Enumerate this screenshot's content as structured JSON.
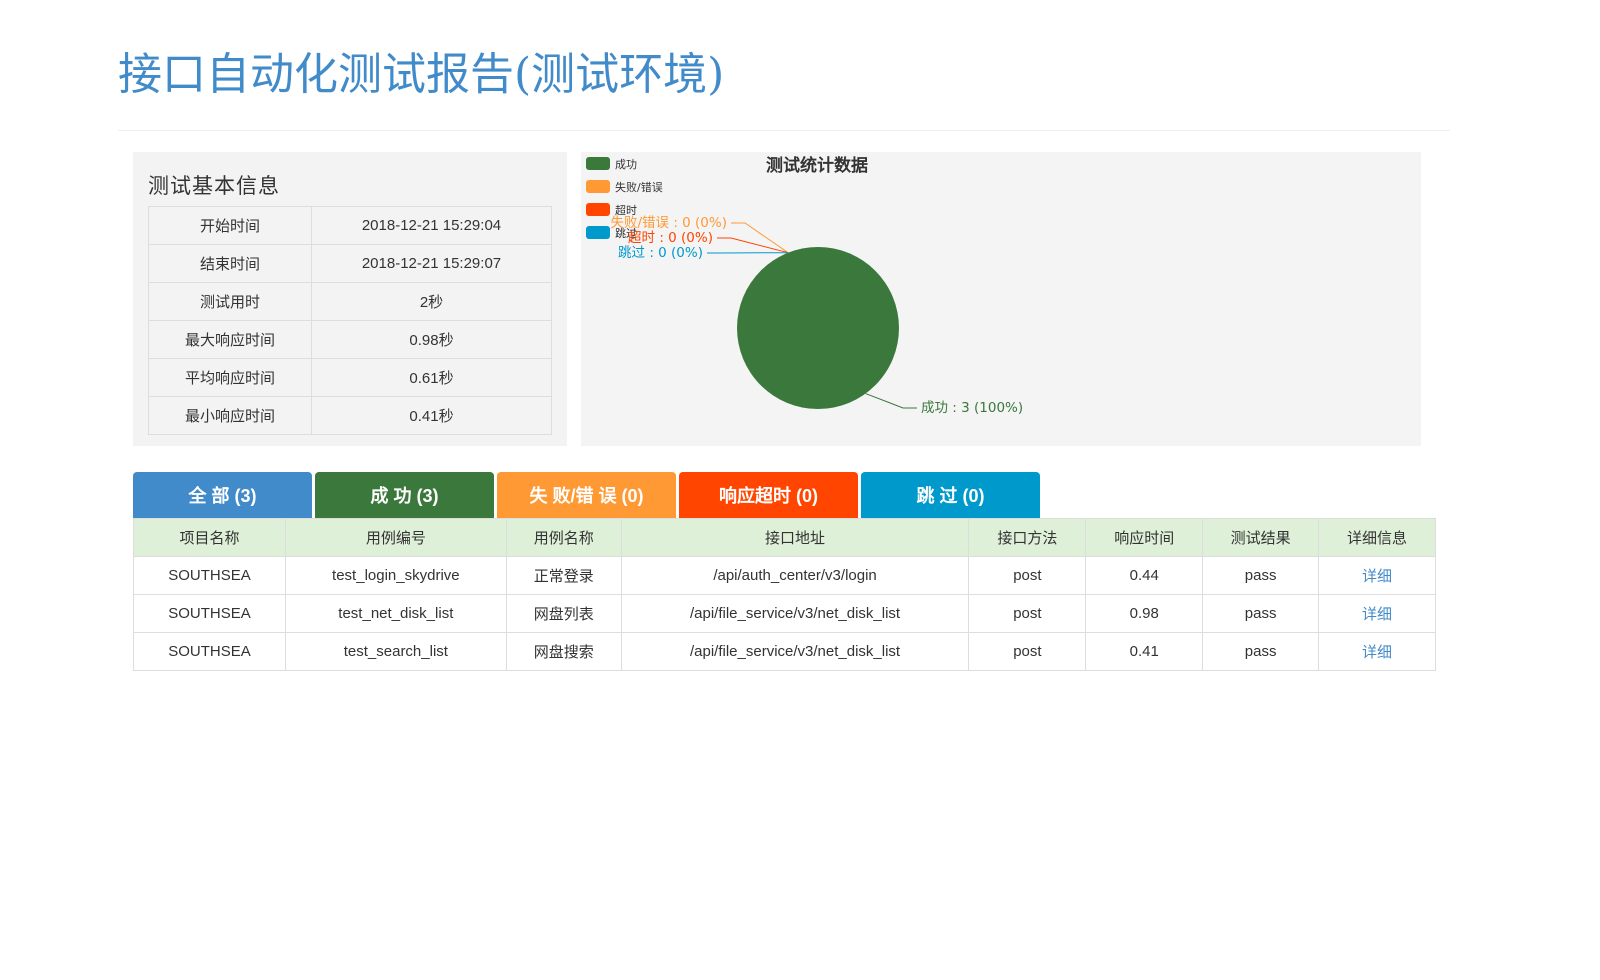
{
  "page": {
    "title": "接口自动化测试报告(测试环境)"
  },
  "basic_info": {
    "title": "测试基本信息",
    "rows": [
      {
        "label": "开始时间",
        "value": "2018-12-21 15:29:04"
      },
      {
        "label": "结束时间",
        "value": "2018-12-21 15:29:07"
      },
      {
        "label": "测试用时",
        "value": "2秒"
      },
      {
        "label": "最大响应时间",
        "value": "0.98秒"
      },
      {
        "label": "平均响应时间",
        "value": "0.61秒"
      },
      {
        "label": "最小响应时间",
        "value": "0.41秒"
      }
    ]
  },
  "chart_data": {
    "type": "pie",
    "title": "测试统计数据",
    "legend_position": "top-left",
    "categories": [
      "成功",
      "失败/错误",
      "超时",
      "跳过"
    ],
    "values": [
      3,
      0,
      0,
      0
    ],
    "colors": [
      "#3b783c",
      "#ff9933",
      "#ff4500",
      "#0099cc"
    ],
    "data_labels": [
      "成功 : 3 (100%)",
      "失败/错误 : 0 (0%)",
      "超时 : 0 (0%)",
      "跳过 : 0 (0%)"
    ]
  },
  "tabs": [
    {
      "label": "全 部 (3)",
      "color": "#428bca"
    },
    {
      "label": "成 功 (3)",
      "color": "#3b783c"
    },
    {
      "label": "失 败/错 误 (0)",
      "color": "#ff9933"
    },
    {
      "label": "响应超时 (0)",
      "color": "#ff4500"
    },
    {
      "label": "跳 过 (0)",
      "color": "#0099cc"
    }
  ],
  "results": {
    "headers": [
      "项目名称",
      "用例编号",
      "用例名称",
      "接口地址",
      "接口方法",
      "响应时间",
      "测试结果",
      "详细信息"
    ],
    "rows": [
      [
        "SOUTHSEA",
        "test_login_skydrive",
        "正常登录",
        "/api/auth_center/v3/login",
        "post",
        "0.44",
        "pass",
        "详细"
      ],
      [
        "SOUTHSEA",
        "test_net_disk_list",
        "网盘列表",
        "/api/file_service/v3/net_disk_list",
        "post",
        "0.98",
        "pass",
        "详细"
      ],
      [
        "SOUTHSEA",
        "test_search_list",
        "网盘搜索",
        "/api/file_service/v3/net_disk_list",
        "post",
        "0.41",
        "pass",
        "详细"
      ]
    ]
  }
}
